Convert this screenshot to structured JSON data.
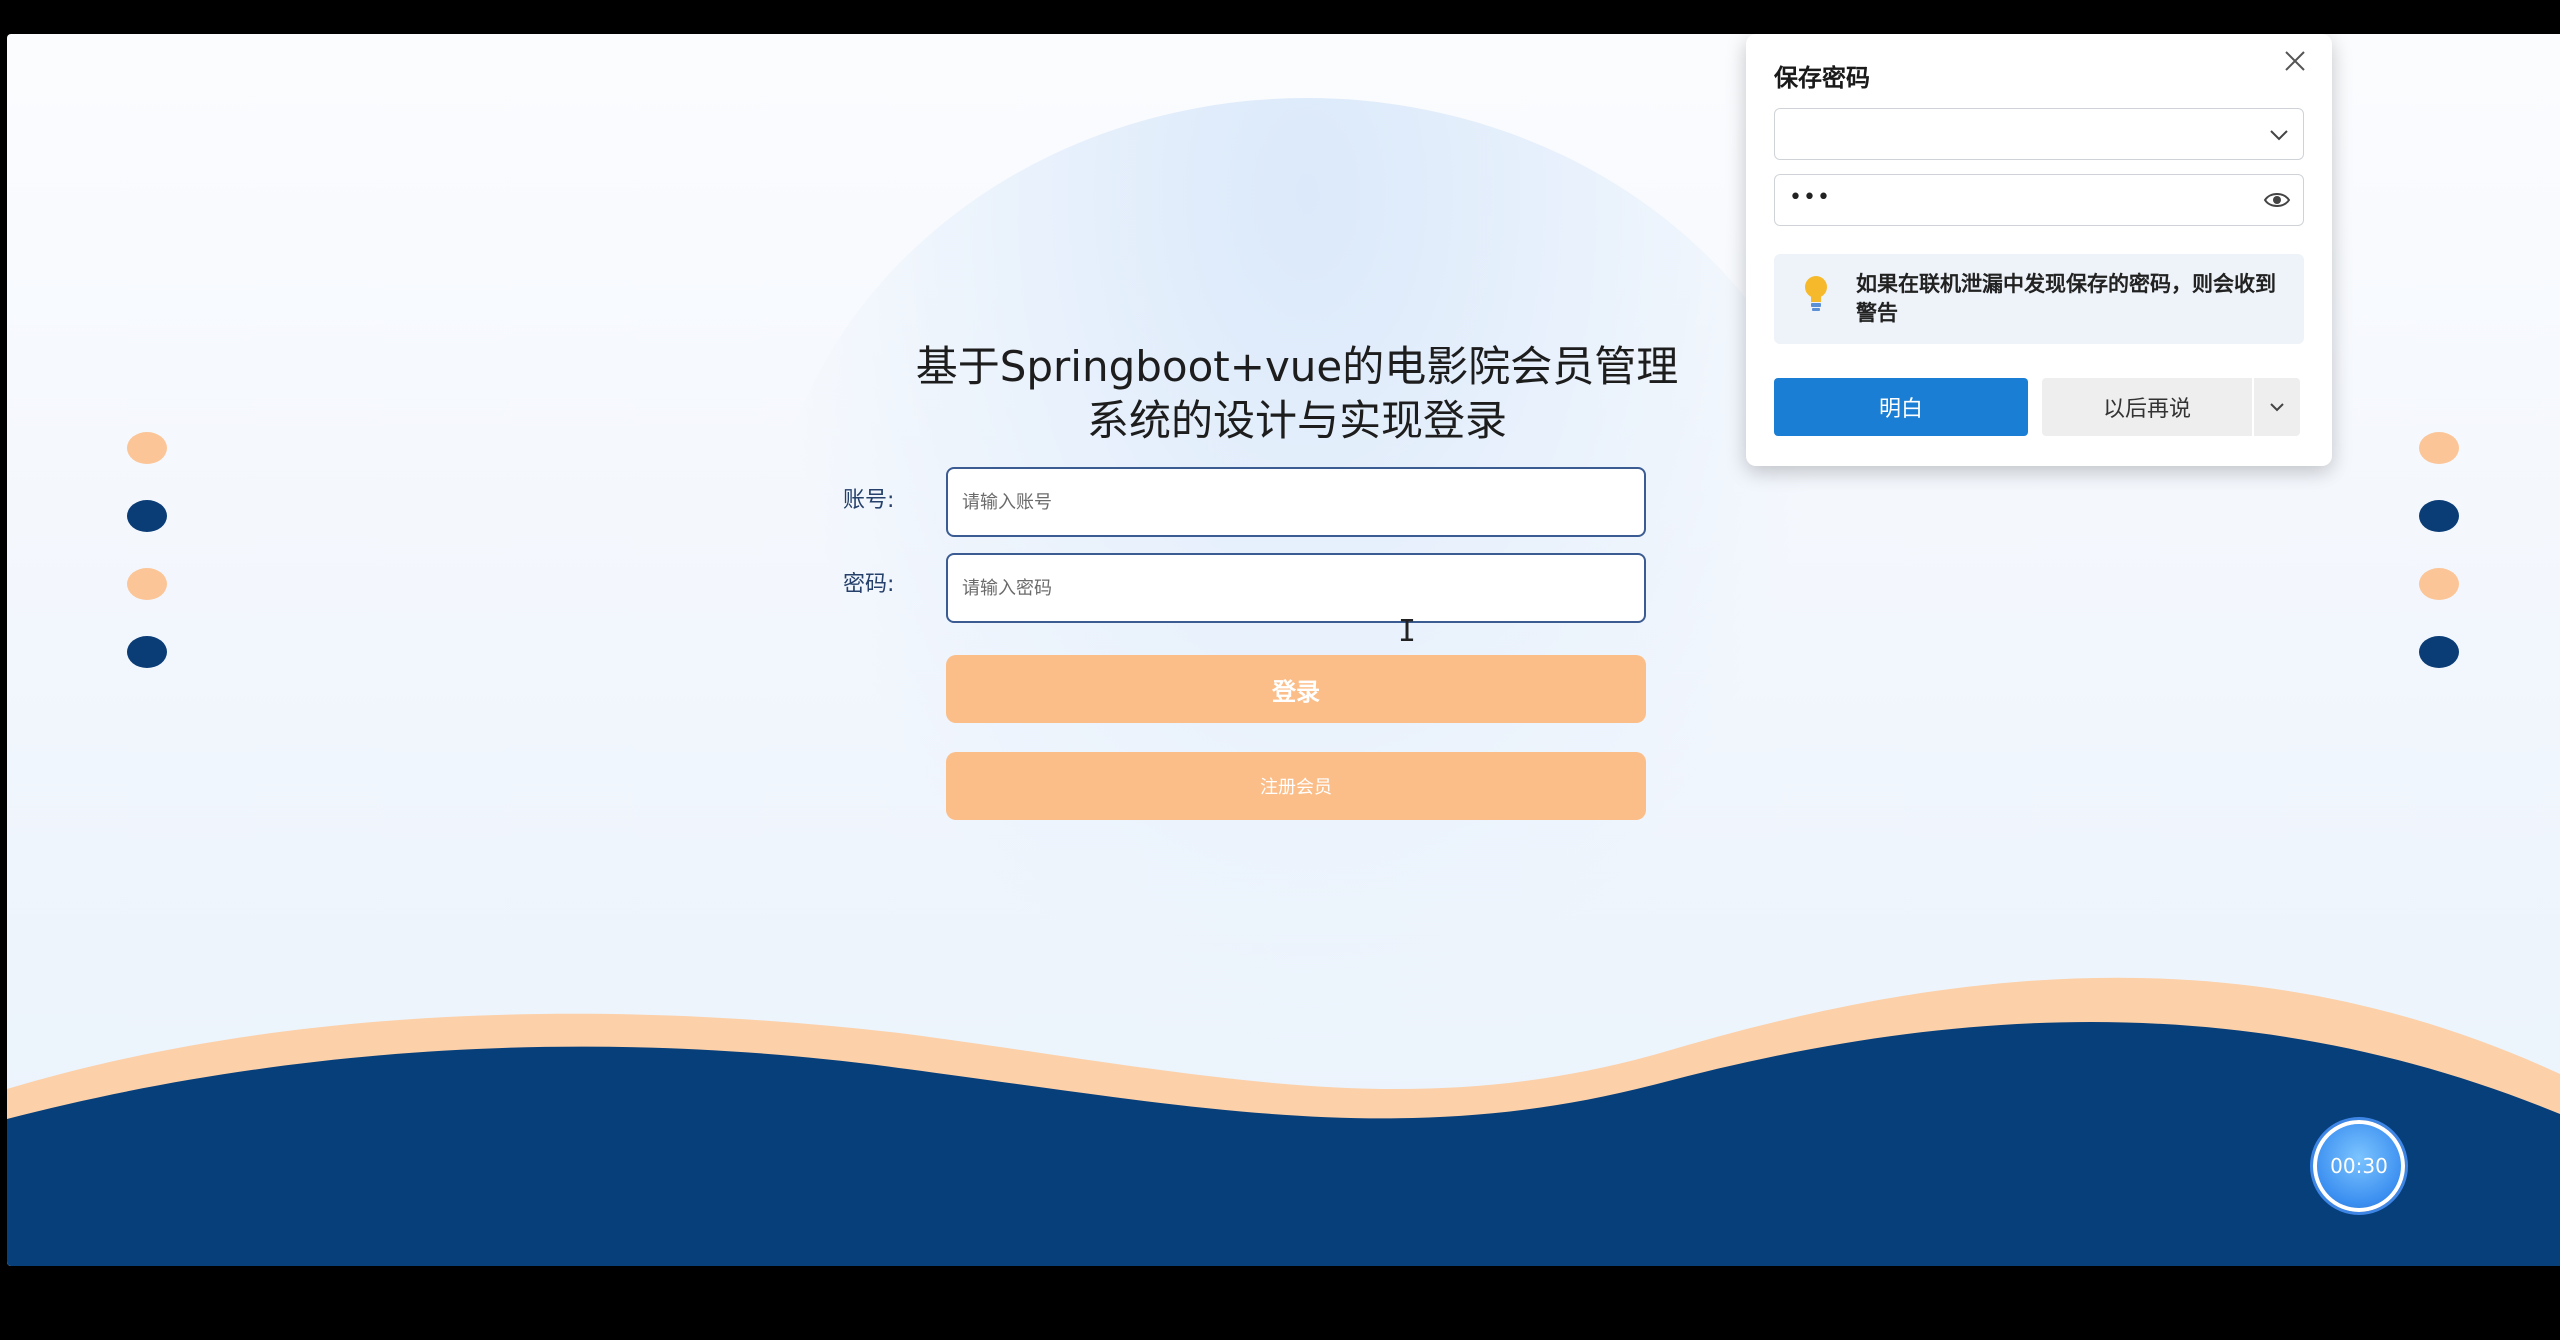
{
  "login": {
    "title": "基于Springboot+vue的电影院会员管理系统的设计与实现登录",
    "account_label": "账号:",
    "account_placeholder": "请输入账号",
    "password_label": "密码:",
    "password_placeholder": "请输入密码",
    "login_button": "登录",
    "register_button": "注册会员"
  },
  "timer": {
    "text": "00:30"
  },
  "password_dialog": {
    "title": "保存密码",
    "username_value": "",
    "password_masked": "•••",
    "warning_text": "如果在联机泄漏中发现保存的密码，则会收到警告",
    "ok_button": "明白",
    "later_button": "以后再说"
  },
  "icons": [
    "close-icon",
    "chevron-down-icon",
    "eye-icon",
    "lightbulb-icon",
    "text-cursor-icon"
  ],
  "colors": {
    "accent_orange": "#fbbe89",
    "navy": "#073f7b",
    "dialog_primary": "#1a7fd4"
  }
}
